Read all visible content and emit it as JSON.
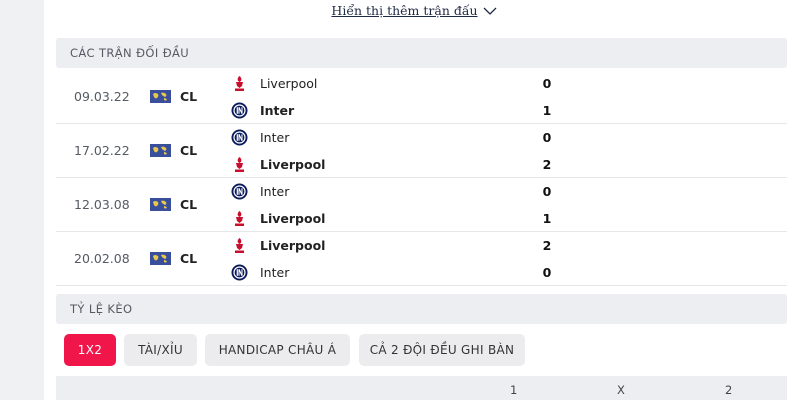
{
  "show_more": {
    "label": "Hiển thị thêm trận đấu"
  },
  "h2h": {
    "title": "CÁC TRẬN ĐỐI ĐẦU",
    "matches": [
      {
        "date": "09.03.22",
        "competition": "CL",
        "home": {
          "name": "Liverpool",
          "score": "0",
          "winner": false,
          "logo": "liverpool-crest"
        },
        "away": {
          "name": "Inter",
          "score": "1",
          "winner": true,
          "logo": "inter-crest"
        }
      },
      {
        "date": "17.02.22",
        "competition": "CL",
        "home": {
          "name": "Inter",
          "score": "0",
          "winner": false,
          "logo": "inter-crest"
        },
        "away": {
          "name": "Liverpool",
          "score": "2",
          "winner": true,
          "logo": "liverpool-crest"
        }
      },
      {
        "date": "12.03.08",
        "competition": "CL",
        "home": {
          "name": "Inter",
          "score": "0",
          "winner": false,
          "logo": "inter-crest"
        },
        "away": {
          "name": "Liverpool",
          "score": "1",
          "winner": true,
          "logo": "liverpool-crest"
        }
      },
      {
        "date": "20.02.08",
        "competition": "CL",
        "home": {
          "name": "Liverpool",
          "score": "2",
          "winner": true,
          "logo": "liverpool-crest"
        },
        "away": {
          "name": "Inter",
          "score": "0",
          "winner": false,
          "logo": "inter-crest"
        }
      }
    ]
  },
  "odds": {
    "title": "TỶ LỆ KÈO",
    "tabs": [
      {
        "label": "1X2",
        "active": true
      },
      {
        "label": "TÀI/XỈU",
        "active": false
      },
      {
        "label": "HANDICAP CHÂU Á",
        "active": false
      },
      {
        "label": "CẢ 2 ĐỘI ĐỀU GHI BÀN",
        "active": false
      }
    ],
    "columns": [
      "1",
      "X",
      "2"
    ]
  },
  "colors": {
    "accent": "#f0164a",
    "liverpool": "#c8102e",
    "inter": "#0a1a5c",
    "header_bg": "#eceef1"
  }
}
